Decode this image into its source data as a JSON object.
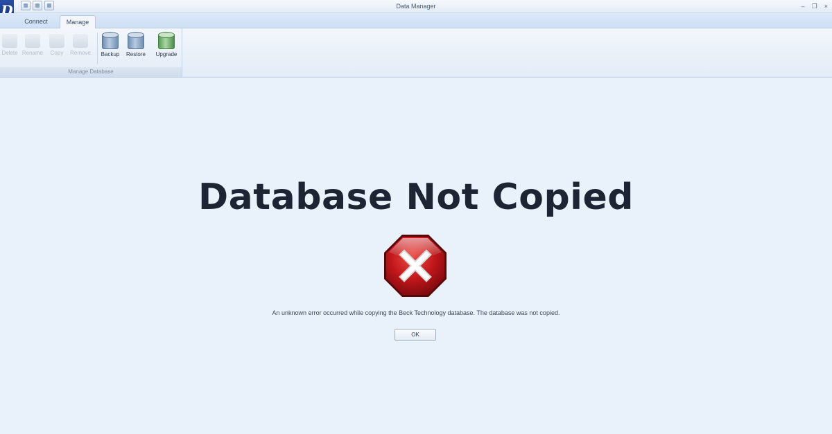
{
  "window": {
    "title": "Data Manager",
    "logo_letter": "D",
    "minimize": "–",
    "restore": "❐",
    "close": "×"
  },
  "tabs": [
    {
      "label": "Connect"
    },
    {
      "label": "Manage"
    }
  ],
  "ribbon": {
    "buttons": [
      {
        "label": "Delete",
        "enabled": false,
        "icon": "database-icon"
      },
      {
        "label": "Rename",
        "enabled": false,
        "icon": "database-icon"
      },
      {
        "label": "Copy",
        "enabled": false,
        "icon": "database-icon"
      },
      {
        "label": "Remove",
        "enabled": false,
        "icon": "database-icon"
      },
      {
        "label": "Backup",
        "enabled": true,
        "icon": "database-backup-icon"
      },
      {
        "label": "Restore",
        "enabled": true,
        "icon": "database-restore-icon"
      },
      {
        "label": "Upgrade",
        "enabled": true,
        "icon": "database-upgrade-icon"
      }
    ],
    "group_label": "Manage Database"
  },
  "dialog": {
    "heading": "Database Not Copied",
    "icon": "error-stop-icon",
    "message": "An unknown error occurred while copying the Beck Technology database. The database was not copied.",
    "ok_label": "OK"
  },
  "colors": {
    "background": "#e9f1fb",
    "heading": "#1d2433",
    "error_red": "#c0161b"
  }
}
